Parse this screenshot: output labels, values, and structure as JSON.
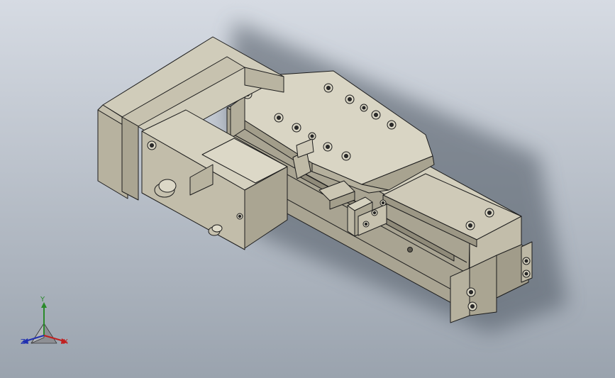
{
  "viewport": {
    "background_top": "#d6dbe3",
    "background_bottom": "#9aa3ae",
    "model_name": "electric-linear-actuator-with-motor",
    "part_color": "#c9c4b1",
    "part_color_dark": "#9f9a88",
    "part_color_light": "#e1ddcd",
    "edge_color": "#1c1c1c"
  },
  "triad": {
    "x_label": "X",
    "y_label": "Y",
    "z_label": "Z",
    "x_color": "#c02020",
    "y_color": "#2a8a2a",
    "z_color": "#2030b0"
  }
}
